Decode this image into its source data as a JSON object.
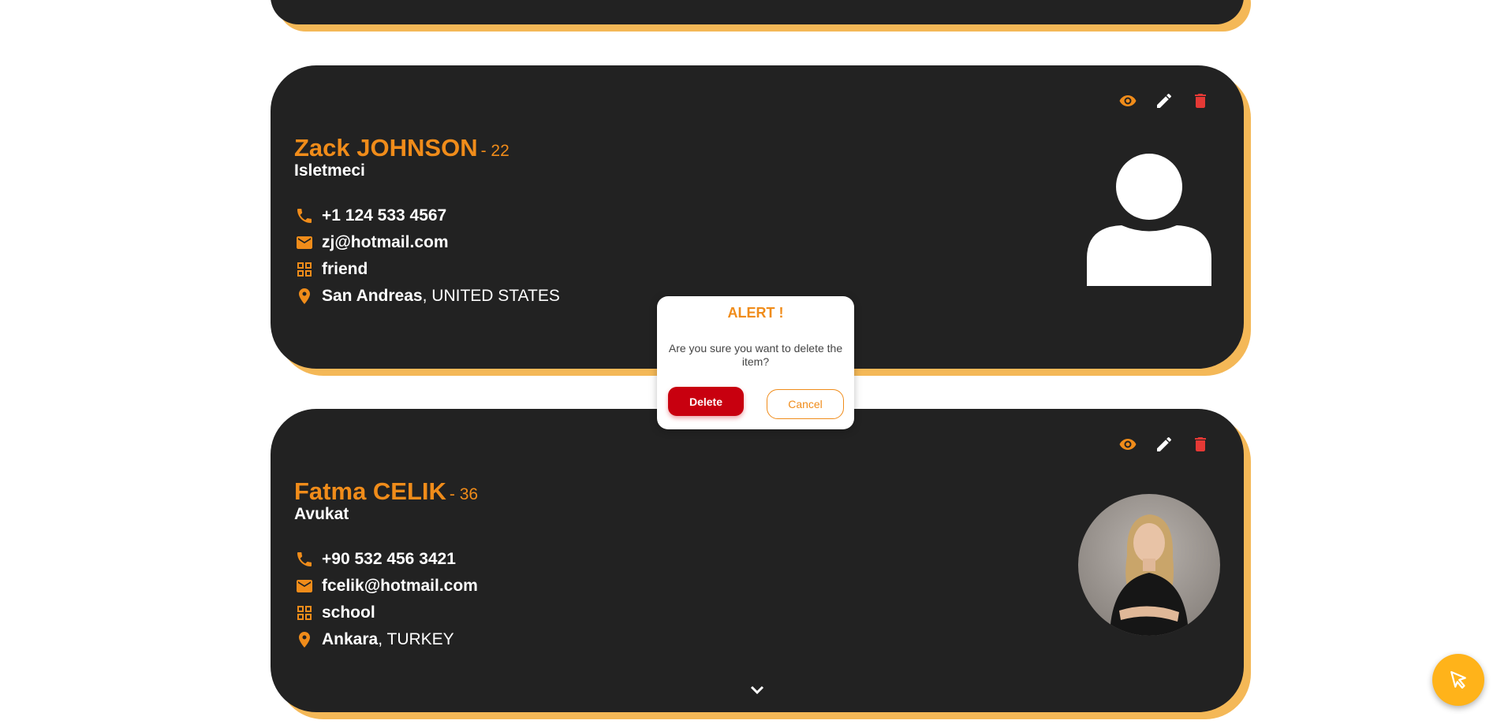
{
  "colors": {
    "card_bg": "#222222",
    "card_shadow": "#f4b857",
    "accent": "#f08c1a",
    "danger": "#e53935",
    "delete_button": "#c8000f",
    "fab": "#ffb31a"
  },
  "contacts": [
    {
      "name": "Zack JOHNSON",
      "age": "- 22",
      "job": "Isletmeci",
      "phone": "+1 124 533 4567",
      "email": "zj@hotmail.com",
      "group": "friend",
      "city": "San Andreas",
      "country": ", UNITED STATES",
      "avatar": "default-user-icon"
    },
    {
      "name": "Fatma CELIK",
      "age": "- 36",
      "job": "Avukat",
      "phone": "+90 532 456 3421",
      "email": "fcelik@hotmail.com",
      "group": "school",
      "city": "Ankara",
      "country": ", TURKEY",
      "avatar": "profile-photo"
    }
  ],
  "icons": {
    "view": "eye-icon",
    "edit": "pencil-icon",
    "delete": "trash-icon",
    "phone": "phone-icon",
    "email": "envelope-icon",
    "group": "grid-icon",
    "location": "map-pin-icon",
    "expand": "chevron-down-icon",
    "fab": "cursor-arrow-icon"
  },
  "modal": {
    "title": "ALERT !",
    "message": "Are you sure you want to delete the item?",
    "delete_label": "Delete",
    "cancel_label": "Cancel"
  }
}
